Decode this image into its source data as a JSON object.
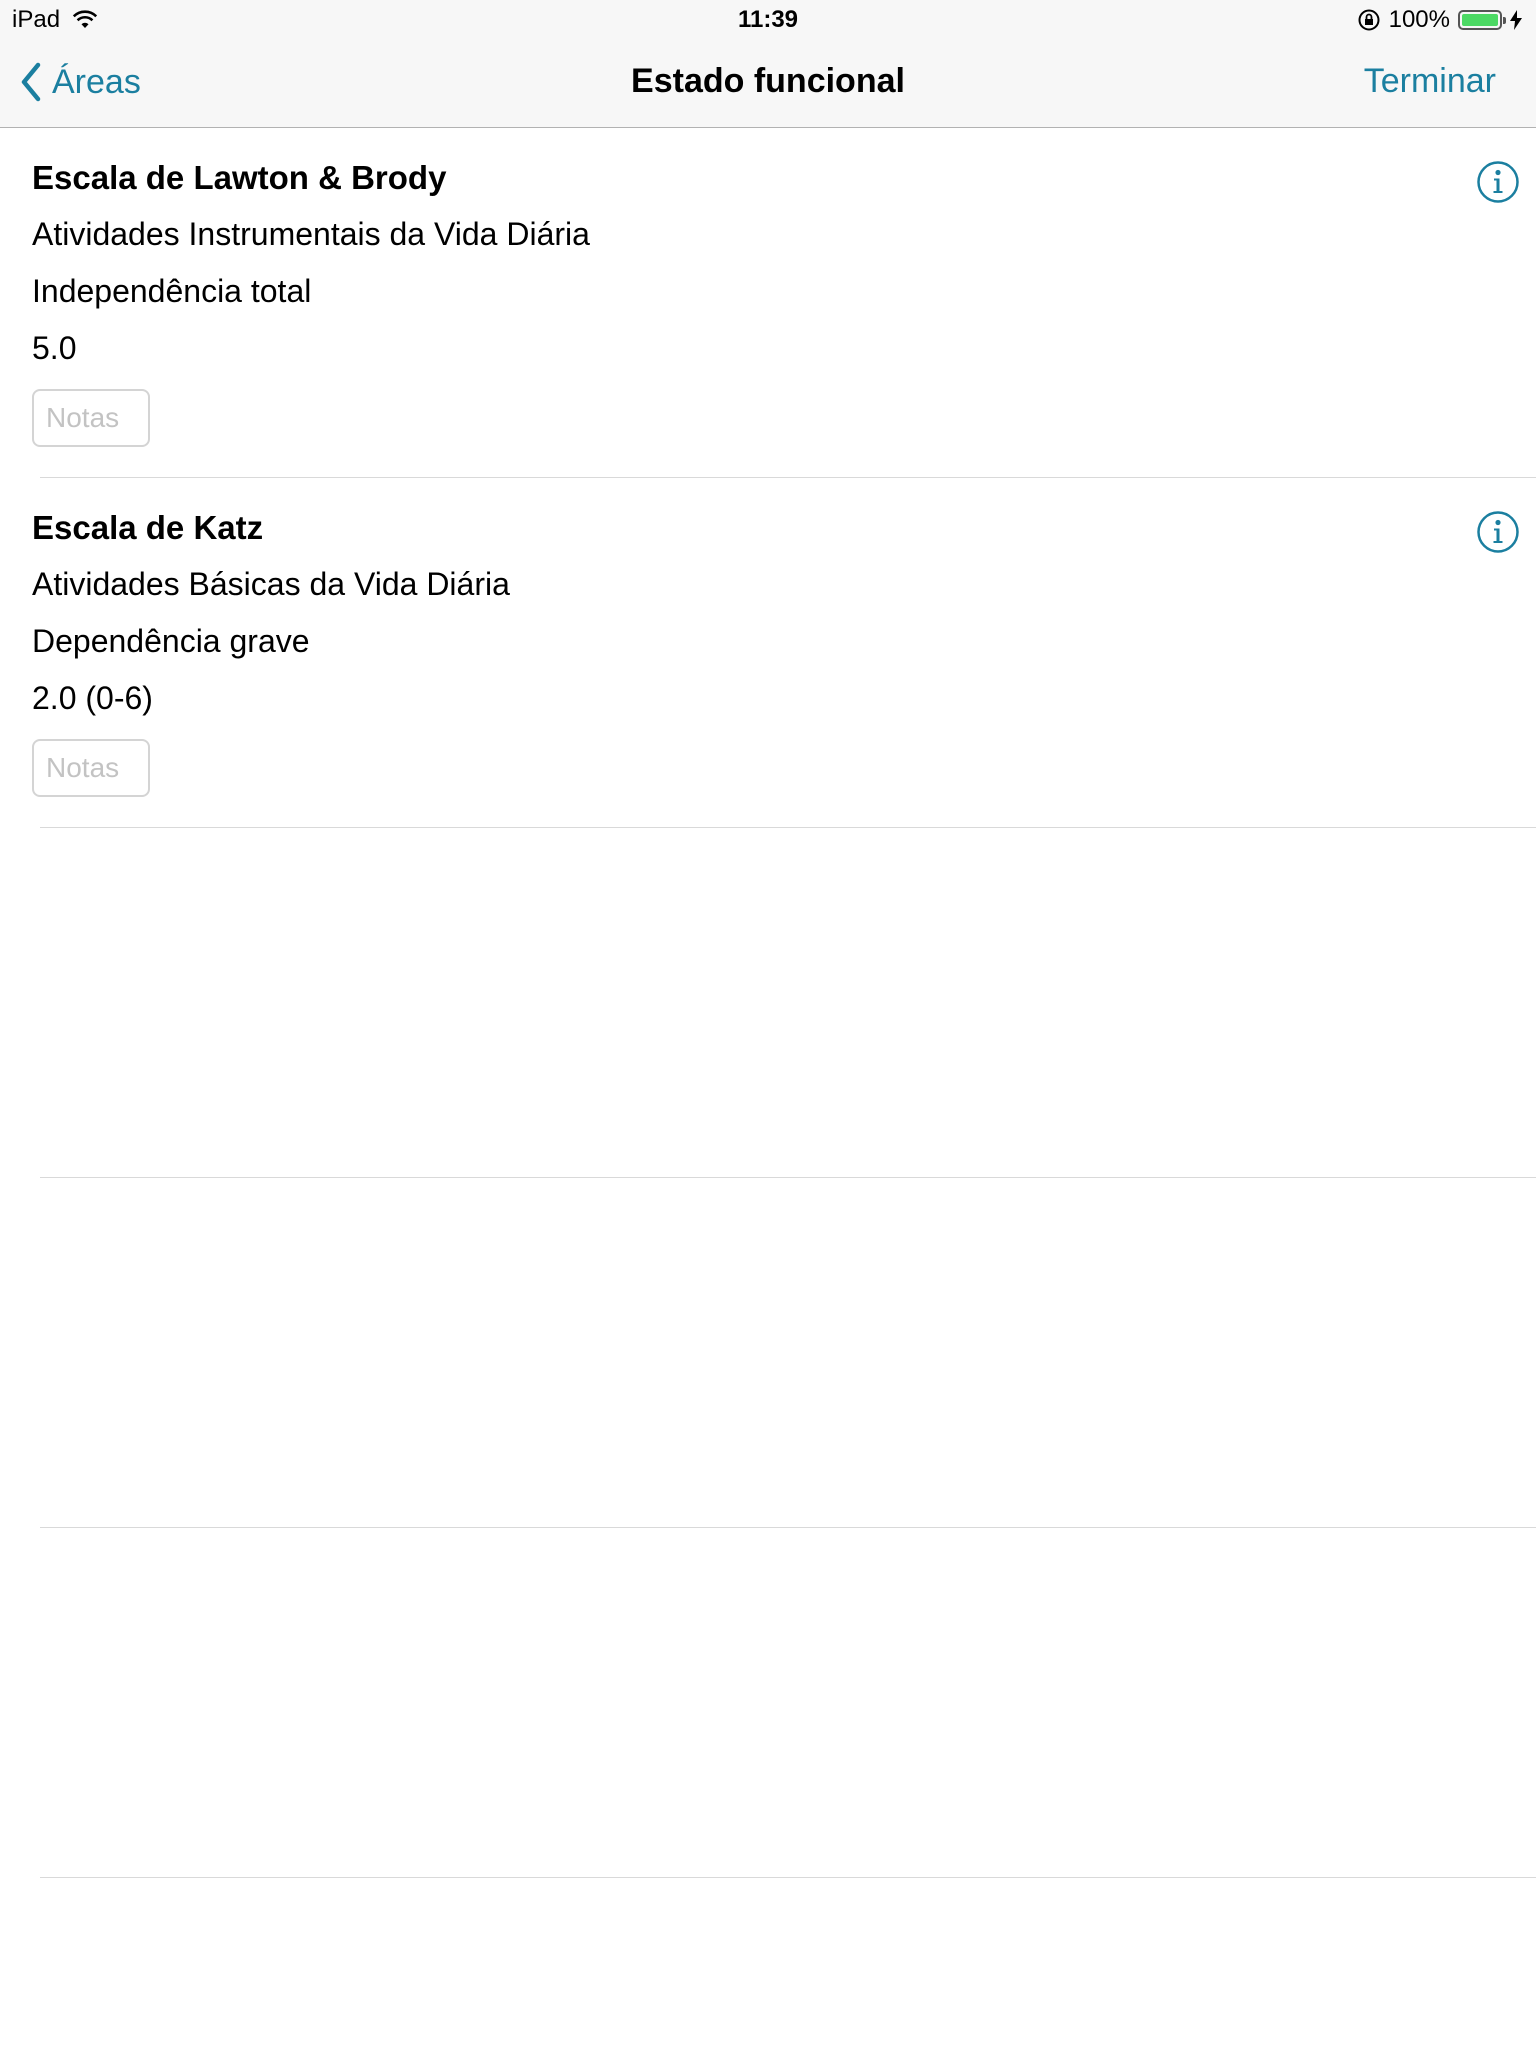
{
  "status_bar": {
    "device": "iPad",
    "time": "11:39",
    "battery": "100%"
  },
  "nav": {
    "back_label": "Áreas",
    "title": "Estado funcional",
    "done_label": "Terminar"
  },
  "scales": [
    {
      "title": "Escala de Lawton & Brody",
      "subtitle": "Atividades Instrumentais da Vida Diária",
      "result": "Independência total",
      "score": "5.0",
      "notes_placeholder": "Notas",
      "notes_value": ""
    },
    {
      "title": "Escala de Katz",
      "subtitle": "Atividades Básicas da Vida Diária",
      "result": "Dependência grave",
      "score": "2.0 (0-6)",
      "notes_placeholder": "Notas",
      "notes_value": ""
    }
  ],
  "colors": {
    "accent": "#1b7fa0",
    "battery": "#4cd964"
  },
  "icons": {
    "back": "chevron-left-icon",
    "info": "info-icon",
    "wifi": "wifi-icon",
    "rotation_lock": "rotation-lock-icon",
    "charging": "bolt-icon"
  }
}
